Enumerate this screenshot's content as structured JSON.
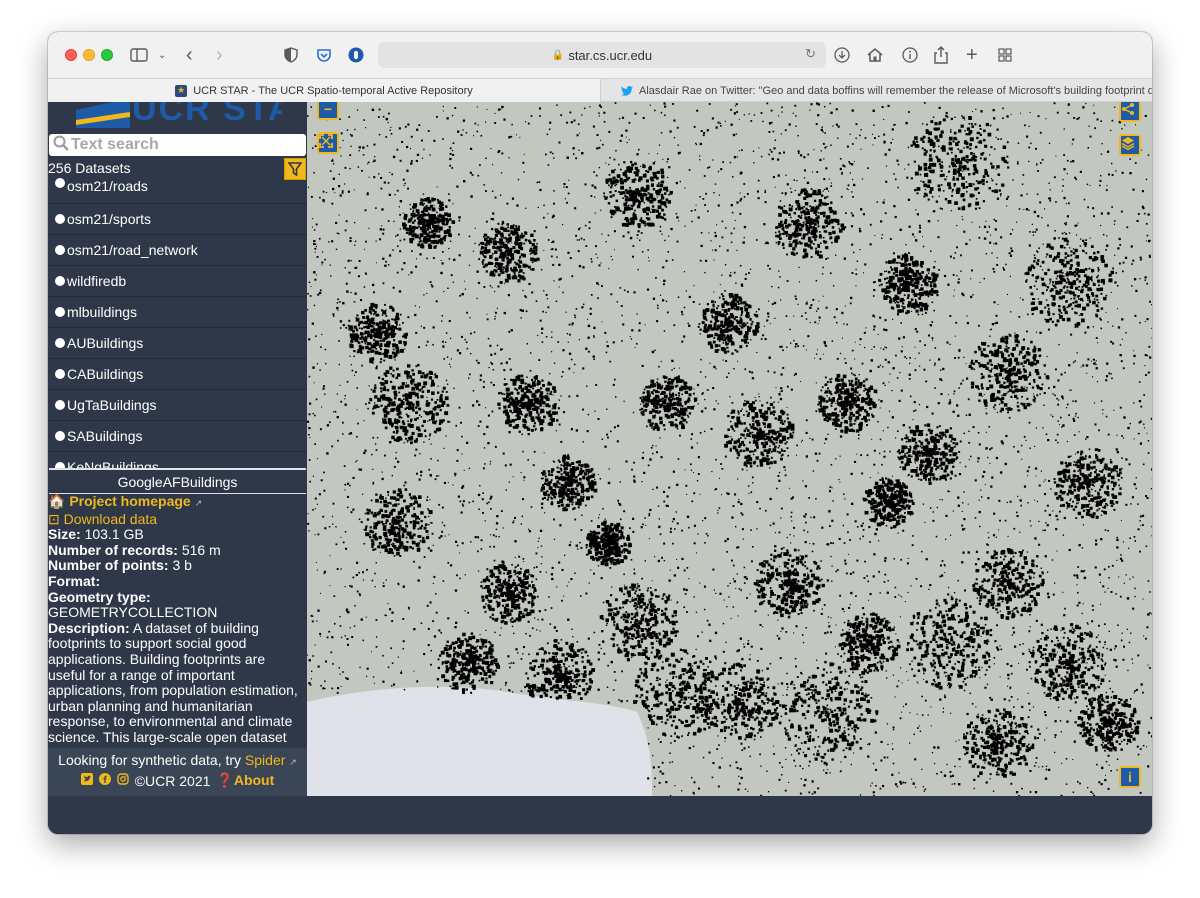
{
  "browser": {
    "url": "star.cs.ucr.edu",
    "tabs": [
      {
        "title": "UCR STAR - The UCR Spatio-temporal Active Repository",
        "active": true,
        "favicon": "star-icon"
      },
      {
        "title": "Alasdair Rae on Twitter: \"Geo and data boffins will remember the release of Microsoft's building footprint data...",
        "active": false,
        "favicon": "twitter-bird-icon"
      }
    ]
  },
  "sidebar": {
    "logo_text": "UCR STAR",
    "search_placeholder": "Text search",
    "dataset_count": "256 Datasets",
    "datasets": [
      "osm21/roads",
      "osm21/sports",
      "osm21/road_network",
      "wildfiredb",
      "mlbuildings",
      "AUBuildings",
      "CABuildings",
      "UgTaBuildings",
      "SABuildings",
      "KeNgBuildings"
    ]
  },
  "detail": {
    "title": "GoogleAFBuildings",
    "homepage_label": "Project homepage",
    "download_label": "Download data",
    "size_label": "Size:",
    "size_value": "103.1 GB",
    "records_label": "Number of records:",
    "records_value": "516 m",
    "points_label": "Number of points:",
    "points_value": "3 b",
    "format_label": "Format:",
    "format_value": "",
    "geometry_label": "Geometry type:",
    "geometry_value": "GEOMETRYCOLLECTION",
    "description_label": "Description:",
    "description_text": "A dataset of building footprints to support social good applications. Building footprints are useful for a range of important applications, from population estimation, urban planning and humanitarian response, to environmental and climate science. This large-scale open dataset contains the outlines of buildings derived from high-resolution"
  },
  "footer": {
    "synthetic_prefix": "Looking for synthetic data, try",
    "spider_label": "Spider",
    "copyright": "©UCR 2021",
    "about_label": "About"
  },
  "map": {
    "zoom_out_label": "−",
    "fullscreen_label": "⤢",
    "share_label": "share",
    "layers_label": "layers",
    "info_label": "i",
    "colors": {
      "land": "#c2c7c0",
      "water": "#dfe2e9",
      "buildings": "#000000",
      "accent": "#f1b81e",
      "button": "#1d5aa8",
      "panel": "#2e3848"
    }
  }
}
